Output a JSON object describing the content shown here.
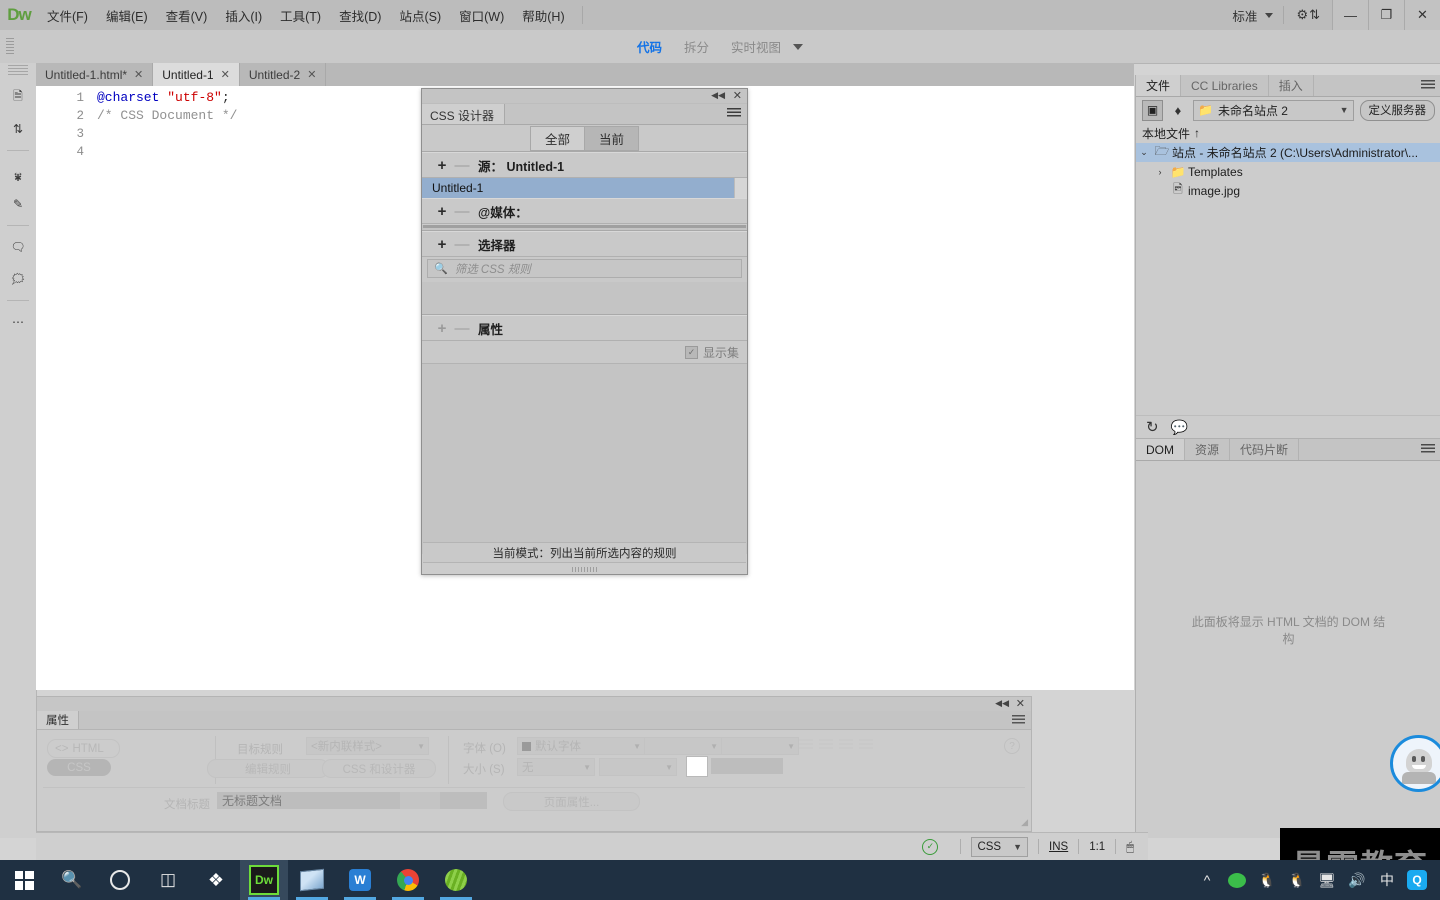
{
  "app": {
    "logo": "Dw",
    "workspace_label": "标准",
    "menu": [
      "文件(F)",
      "编辑(E)",
      "查看(V)",
      "插入(I)",
      "工具(T)",
      "查找(D)",
      "站点(S)",
      "窗口(W)",
      "帮助(H)"
    ],
    "window_controls": {
      "minimize": "—",
      "maximize": "❐",
      "close": "✕"
    }
  },
  "doc_toolbar": {
    "views": [
      {
        "label": "代码",
        "active": true
      },
      {
        "label": "拆分",
        "active": false
      },
      {
        "label": "实时视图",
        "active": false
      }
    ]
  },
  "left_rail": {
    "icons": [
      "new-file-icon",
      "sort-arrows-icon",
      "format-source-icon",
      "code-highlight-icon",
      "comment-icon",
      "uncomment-icon",
      "more-options-icon"
    ]
  },
  "tabs": [
    {
      "label": "Untitled-1.html*",
      "active": false
    },
    {
      "label": "Untitled-1",
      "active": true
    },
    {
      "label": "Untitled-2",
      "active": false
    }
  ],
  "code": {
    "lines": [
      {
        "num": "1",
        "segments": [
          {
            "text": "@charset",
            "type": "at"
          },
          {
            "text": " ",
            "type": "plain"
          },
          {
            "text": "\"utf-8\"",
            "type": "str"
          },
          {
            "text": ";",
            "type": "plain"
          }
        ]
      },
      {
        "num": "2",
        "segments": [
          {
            "text": "/* CSS Document */",
            "type": "cmt"
          }
        ]
      },
      {
        "num": "3",
        "segments": []
      },
      {
        "num": "4",
        "segments": []
      }
    ]
  },
  "css_designer": {
    "tab_label": "CSS 设计器",
    "modes": [
      {
        "label": "全部",
        "active": false
      },
      {
        "label": "当前",
        "active": true
      }
    ],
    "source_section": {
      "title": "源：",
      "value": "Untitled-1",
      "add": "+",
      "remove": "—"
    },
    "source_items": [
      {
        "label": "Untitled-1",
        "selected": true
      }
    ],
    "media_section": {
      "title": "@媒体：",
      "add": "+",
      "remove": "—"
    },
    "selector_section": {
      "title": "选择器",
      "add": "+",
      "remove": "—"
    },
    "filter_placeholder": "筛选 CSS 规则",
    "properties_section": {
      "title": "属性",
      "add": "+",
      "remove": "—"
    },
    "show_set_label": "显示集",
    "show_set_checked": true,
    "status": "当前模式：列出当前所选内容的规则"
  },
  "right_dock": {
    "tabs": [
      {
        "label": "文件",
        "active": true
      },
      {
        "label": "CC Libraries",
        "active": false
      },
      {
        "label": "插入",
        "active": false
      }
    ],
    "site_select_value": "未命名站点 2",
    "define_server_label": "定义服务器",
    "local_files_label": "本地文件",
    "sort_arrow": "↑",
    "tree": [
      {
        "label": "站点 - 未命名站点 2 (C:\\Users\\Administrator\\...",
        "icon": "folder-open-icon",
        "indent": 0,
        "arrow": "⌄",
        "selected": true
      },
      {
        "label": "Templates",
        "icon": "folder-icon",
        "indent": 1,
        "arrow": "›",
        "selected": false
      },
      {
        "label": "image.jpg",
        "icon": "image-file-icon",
        "indent": 1,
        "arrow": "",
        "selected": false
      }
    ],
    "bottom_tools": [
      "refresh-icon",
      "connect-remote-icon"
    ],
    "dom_tabs": [
      {
        "label": "DOM",
        "active": true
      },
      {
        "label": "资源",
        "active": false
      },
      {
        "label": "代码片断",
        "active": false
      }
    ],
    "dom_message": "此面板将显示 HTML 文档的 DOM 结构"
  },
  "properties_panel": {
    "tab_label": "属性",
    "html_label": "HTML",
    "css_label": "CSS",
    "target_rule_label": "目标规则",
    "target_rule_value": "<新内联样式>",
    "edit_rule_label": "编辑规则",
    "css_designer_btn_label": "CSS 和设计器",
    "font_label": "字体 (O)",
    "font_value": "默认字体",
    "size_label": "大小 (S)",
    "size_value": "无",
    "doc_title_label": "文档标题",
    "doc_title_value": "无标题文档",
    "page_props_label": "页面属性...",
    "help_icon": "?"
  },
  "status_bar": {
    "validation_icon": "check-circle-icon",
    "format_value": "CSS",
    "insert_mode": "INS",
    "cursor_position": "1:1",
    "preview_icon": "preview-in-browser-icon"
  },
  "feedback_bubble": {
    "name": "feedback-avatar"
  },
  "watermark": {
    "text": "最需教育"
  },
  "taskbar": {
    "items": [
      {
        "name": "start-button",
        "icon": "windows-logo-icon"
      },
      {
        "name": "search-button",
        "icon": "search-icon"
      },
      {
        "name": "cortana-button",
        "icon": "circle-icon"
      },
      {
        "name": "task-view-button",
        "icon": "task-view-icon"
      },
      {
        "name": "app-sogou",
        "icon": "sogou-icon"
      },
      {
        "name": "app-dreamweaver",
        "icon": "dw-icon",
        "label": "Dw",
        "active": true
      },
      {
        "name": "app-notepad",
        "icon": "notepad-icon"
      },
      {
        "name": "app-wps",
        "icon": "wps-icon",
        "label": "W"
      },
      {
        "name": "app-chrome",
        "icon": "chrome-icon"
      },
      {
        "name": "app-green",
        "icon": "green-app-icon"
      }
    ],
    "tray": [
      {
        "name": "show-hidden-icons",
        "icon": "chevron-up-icon"
      },
      {
        "name": "wechat-tray",
        "icon": "wechat-icon"
      },
      {
        "name": "qq-tray-1",
        "icon": "penguin-icon"
      },
      {
        "name": "qq-tray-2",
        "icon": "penguin-girl-icon"
      },
      {
        "name": "network-tray",
        "icon": "network-icon"
      },
      {
        "name": "volume-tray",
        "icon": "speaker-icon"
      },
      {
        "name": "ime-tray",
        "icon": "ime-icon",
        "label": "中"
      },
      {
        "name": "qq-browser-tray",
        "icon": "q-icon",
        "label": "Q"
      }
    ]
  }
}
